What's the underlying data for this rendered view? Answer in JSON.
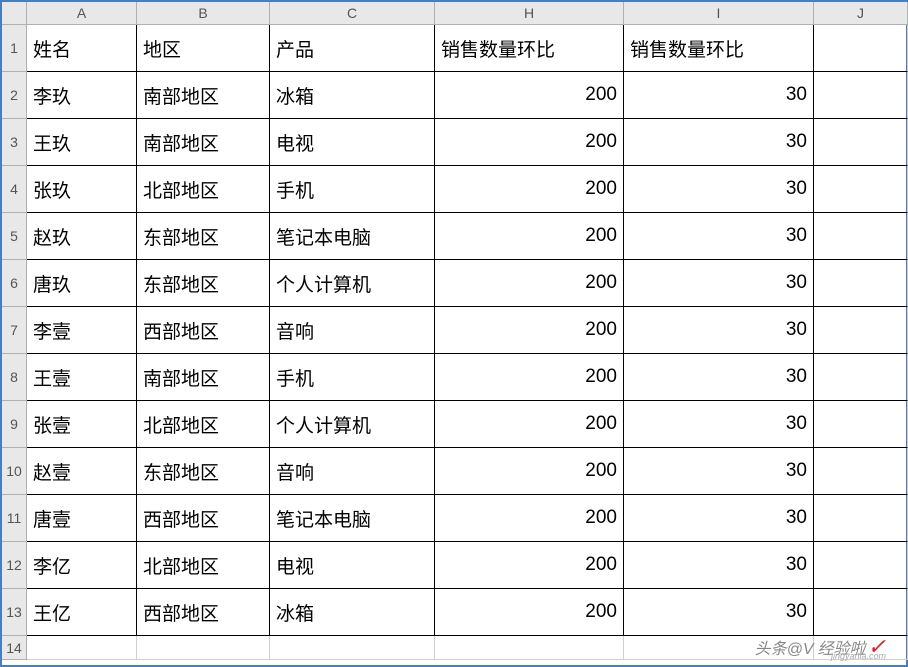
{
  "columns": {
    "corner": "",
    "headers": [
      "A",
      "B",
      "C",
      "H",
      "I",
      "J"
    ]
  },
  "rowHeaders": [
    "1",
    "2",
    "3",
    "4",
    "5",
    "6",
    "7",
    "8",
    "9",
    "10",
    "11",
    "12",
    "13",
    "14"
  ],
  "header": {
    "name": "姓名",
    "region": "地区",
    "product": "产品",
    "salesQty1": "销售数量环比",
    "salesQty2": "销售数量环比"
  },
  "rows": [
    {
      "name": "李玖",
      "region": "南部地区",
      "product": "冰箱",
      "qty1": "200",
      "qty2": "30"
    },
    {
      "name": "王玖",
      "region": "南部地区",
      "product": "电视",
      "qty1": "200",
      "qty2": "30"
    },
    {
      "name": "张玖",
      "region": "北部地区",
      "product": "手机",
      "qty1": "200",
      "qty2": "30"
    },
    {
      "name": "赵玖",
      "region": "东部地区",
      "product": "笔记本电脑",
      "qty1": "200",
      "qty2": "30"
    },
    {
      "name": "唐玖",
      "region": "东部地区",
      "product": "个人计算机",
      "qty1": "200",
      "qty2": "30"
    },
    {
      "name": "李壹",
      "region": "西部地区",
      "product": "音响",
      "qty1": "200",
      "qty2": "30"
    },
    {
      "name": "王壹",
      "region": "南部地区",
      "product": "手机",
      "qty1": "200",
      "qty2": "30"
    },
    {
      "name": "张壹",
      "region": "北部地区",
      "product": "个人计算机",
      "qty1": "200",
      "qty2": "30"
    },
    {
      "name": "赵壹",
      "region": "东部地区",
      "product": "音响",
      "qty1": "200",
      "qty2": "30"
    },
    {
      "name": "唐壹",
      "region": "西部地区",
      "product": "笔记本电脑",
      "qty1": "200",
      "qty2": "30"
    },
    {
      "name": "李亿",
      "region": "北部地区",
      "product": "电视",
      "qty1": "200",
      "qty2": "30"
    },
    {
      "name": "王亿",
      "region": "西部地区",
      "product": "冰箱",
      "qty1": "200",
      "qty2": "30"
    }
  ],
  "watermark": {
    "text1": "头条@V",
    "text2": "经验啦",
    "sub": "jingyanla.com"
  }
}
